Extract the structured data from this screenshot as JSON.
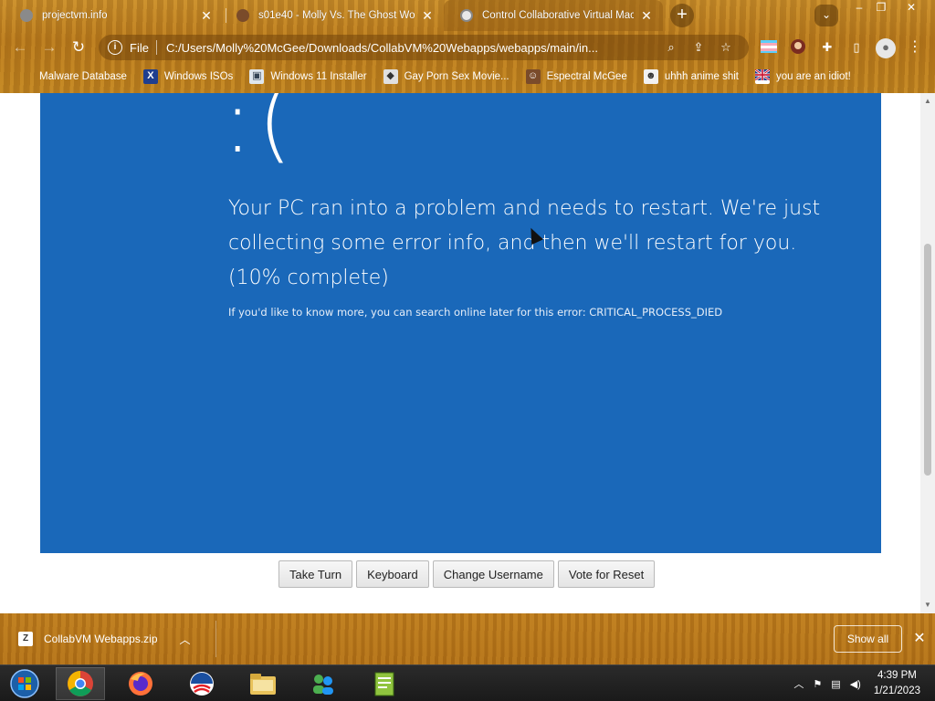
{
  "browser": {
    "tabs": [
      {
        "title": "projectvm.info",
        "active": false
      },
      {
        "title": "s01e40 - Molly Vs. The Ghost Wo",
        "active": false
      },
      {
        "title": "Control Collaborative Virtual Mac",
        "active": true
      }
    ],
    "new_tab": "+",
    "tab_search": "⌄",
    "window_controls": [
      "–",
      "❐",
      "✕"
    ],
    "address": {
      "scheme_label": "File",
      "url": "C:/Users/Molly%20McGee/Downloads/CollabVM%20Webapps/webapps/main/in..."
    },
    "bookmarks": [
      {
        "label": "Malware Database",
        "icon": "malware-icon"
      },
      {
        "label": "Windows ISOs",
        "icon": "x-icon"
      },
      {
        "label": "Windows 11 Installer",
        "icon": "picture-icon"
      },
      {
        "label": "Gay Porn Sex Movie...",
        "icon": "cube-icon"
      },
      {
        "label": "Espectral McGee",
        "icon": "character-icon"
      },
      {
        "label": "uhhh anime shit",
        "icon": "anime-icon"
      },
      {
        "label": "you are an idiot!",
        "icon": "flag-icon"
      }
    ]
  },
  "vm_screen": {
    "emoticon": ":(",
    "message": "Your PC ran into a problem and needs to restart. We're just collecting some error info, and then we'll restart for you. (10% complete)",
    "info": "If you'd like to know more, you can search online later for this error: CRITICAL_PROCESS_DIED",
    "progress_percent": 10,
    "background_color": "#1a68b9"
  },
  "controls": {
    "take_turn": "Take Turn",
    "keyboard": "Keyboard",
    "change_username": "Change Username",
    "vote_reset": "Vote for Reset"
  },
  "download_bar": {
    "file_name": "CollabVM Webapps.zip",
    "show_all": "Show all"
  },
  "taskbar": {
    "apps": [
      "start-orb",
      "chrome",
      "firefox",
      "obama-logo",
      "file-explorer",
      "network-app",
      "notepad-plus-plus"
    ],
    "clock_time": "4:39 PM",
    "clock_date": "1/21/2023"
  },
  "colors": {
    "frame_wood": "#c08420",
    "bsod_blue": "#1a68b9",
    "taskbar": "#1f1f1f"
  }
}
